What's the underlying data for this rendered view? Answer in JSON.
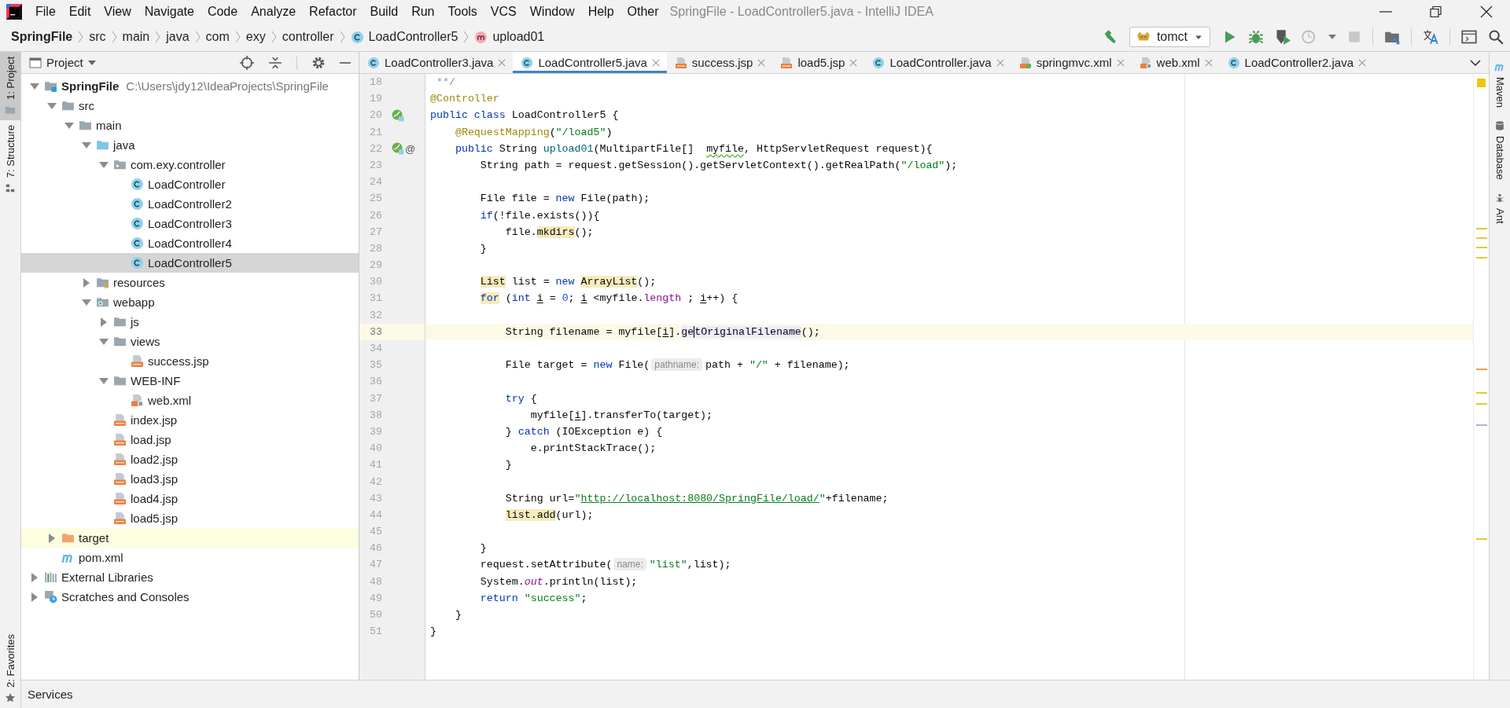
{
  "window": {
    "title": "SpringFile - LoadController5.java - IntelliJ IDEA"
  },
  "menu": [
    "File",
    "Edit",
    "View",
    "Navigate",
    "Code",
    "Analyze",
    "Refactor",
    "Build",
    "Run",
    "Tools",
    "VCS",
    "Window",
    "Help",
    "Other"
  ],
  "breadcrumbs": [
    {
      "label": "SpringFile",
      "kind": "path"
    },
    {
      "label": "src",
      "kind": "path"
    },
    {
      "label": "main",
      "kind": "path"
    },
    {
      "label": "java",
      "kind": "path"
    },
    {
      "label": "com",
      "kind": "path"
    },
    {
      "label": "exy",
      "kind": "path"
    },
    {
      "label": "controller",
      "kind": "path"
    },
    {
      "label": "LoadController5",
      "kind": "class"
    },
    {
      "label": "upload01",
      "kind": "method"
    }
  ],
  "run_config": {
    "label": "tomct"
  },
  "left_stripe": [
    {
      "label": "1: Project",
      "kind": "folder",
      "selected": true
    },
    {
      "label": "7: Structure",
      "kind": "structure",
      "selected": false
    },
    {
      "label": "2: Favorites",
      "kind": "star",
      "selected": false
    }
  ],
  "right_stripe": [
    {
      "label": "Maven",
      "kind": "m"
    },
    {
      "label": "Database",
      "kind": "db"
    },
    {
      "label": "Ant",
      "kind": "ant"
    }
  ],
  "project": {
    "title": "Project",
    "tree": [
      {
        "label": "SpringFile",
        "note": "C:\\Users\\jdy12\\IdeaProjects\\SpringFile",
        "kind": "module",
        "expanded": true,
        "selected": false,
        "highlighted": false,
        "children": [
          {
            "label": "src",
            "kind": "folder",
            "expanded": true,
            "selected": false,
            "highlighted": false,
            "children": [
              {
                "label": "main",
                "kind": "folder",
                "expanded": true,
                "selected": false,
                "highlighted": false,
                "children": [
                  {
                    "label": "java",
                    "kind": "source",
                    "expanded": true,
                    "selected": false,
                    "highlighted": false,
                    "children": [
                      {
                        "label": "com.exy.controller",
                        "kind": "package",
                        "expanded": true,
                        "selected": false,
                        "highlighted": false,
                        "children": [
                          {
                            "label": "LoadController",
                            "kind": "class",
                            "selected": false,
                            "highlighted": false
                          },
                          {
                            "label": "LoadController2",
                            "kind": "class",
                            "selected": false,
                            "highlighted": false
                          },
                          {
                            "label": "LoadController3",
                            "kind": "class",
                            "selected": false,
                            "highlighted": false
                          },
                          {
                            "label": "LoadController4",
                            "kind": "class",
                            "selected": false,
                            "highlighted": false
                          },
                          {
                            "label": "LoadController5",
                            "kind": "class",
                            "selected": true,
                            "highlighted": false
                          }
                        ]
                      }
                    ]
                  },
                  {
                    "label": "resources",
                    "kind": "resources",
                    "expanded": false,
                    "selected": false,
                    "highlighted": false
                  },
                  {
                    "label": "webapp",
                    "kind": "web",
                    "expanded": true,
                    "selected": false,
                    "highlighted": false,
                    "children": [
                      {
                        "label": "js",
                        "kind": "folder",
                        "expanded": false,
                        "selected": false,
                        "highlighted": false
                      },
                      {
                        "label": "views",
                        "kind": "folder",
                        "expanded": true,
                        "selected": false,
                        "highlighted": false,
                        "children": [
                          {
                            "label": "success.jsp",
                            "kind": "jsp",
                            "selected": false,
                            "highlighted": false
                          }
                        ]
                      },
                      {
                        "label": "WEB-INF",
                        "kind": "folder",
                        "expanded": true,
                        "selected": false,
                        "highlighted": false,
                        "children": [
                          {
                            "label": "web.xml",
                            "kind": "xml",
                            "selected": false,
                            "highlighted": false
                          }
                        ]
                      },
                      {
                        "label": "index.jsp",
                        "kind": "jsp",
                        "selected": false,
                        "highlighted": false
                      },
                      {
                        "label": "load.jsp",
                        "kind": "jsp",
                        "selected": false,
                        "highlighted": false
                      },
                      {
                        "label": "load2.jsp",
                        "kind": "jsp",
                        "selected": false,
                        "highlighted": false
                      },
                      {
                        "label": "load3.jsp",
                        "kind": "jsp",
                        "selected": false,
                        "highlighted": false
                      },
                      {
                        "label": "load4.jsp",
                        "kind": "jsp",
                        "selected": false,
                        "highlighted": false
                      },
                      {
                        "label": "load5.jsp",
                        "kind": "jsp",
                        "selected": false,
                        "highlighted": false
                      }
                    ]
                  }
                ]
              }
            ]
          },
          {
            "label": "target",
            "kind": "excluded",
            "expanded": false,
            "selected": false,
            "highlighted": true
          },
          {
            "label": "pom.xml",
            "kind": "m",
            "selected": false,
            "highlighted": false
          }
        ]
      },
      {
        "label": "External Libraries",
        "kind": "libraries",
        "expanded": false,
        "selected": false,
        "highlighted": false
      },
      {
        "label": "Scratches and Consoles",
        "kind": "scratches",
        "expanded": false,
        "selected": false,
        "highlighted": false
      }
    ]
  },
  "editor": {
    "tabs": [
      {
        "label": "LoadController3.java",
        "kind": "class",
        "selected": false
      },
      {
        "label": "LoadController5.java",
        "kind": "class",
        "selected": true
      },
      {
        "label": "success.jsp",
        "kind": "jsp",
        "selected": false
      },
      {
        "label": "load5.jsp",
        "kind": "jsp",
        "selected": false
      },
      {
        "label": "LoadController.java",
        "kind": "class",
        "selected": false
      },
      {
        "label": "springmvc.xml",
        "kind": "spring",
        "selected": false
      },
      {
        "label": "web.xml",
        "kind": "xml",
        "selected": false
      },
      {
        "label": "LoadController2.java",
        "kind": "class",
        "selected": false
      }
    ],
    "lines": [
      {
        "number": "18",
        "current": false,
        "tokens": [
          {
            "kind": "comment",
            "text": " **/"
          }
        ]
      },
      {
        "number": "19",
        "current": false,
        "tokens": [
          {
            "kind": "ann",
            "text": "@Controller"
          }
        ]
      },
      {
        "number": "20",
        "current": false,
        "gutter": [
          {
            "kind": "bean"
          }
        ],
        "tokens": [
          {
            "kind": "kw",
            "text": "public class"
          },
          {
            "kind": "plain",
            "text": " LoadController5 {"
          }
        ]
      },
      {
        "number": "21",
        "current": false,
        "tokens": [
          {
            "kind": "ann",
            "text": "@RequestMapping"
          },
          {
            "kind": "plain",
            "text": "("
          },
          {
            "kind": "str",
            "text": "\"/load5\""
          },
          {
            "kind": "plain",
            "text": ")"
          }
        ]
      },
      {
        "number": "22",
        "current": false,
        "gutter": [
          {
            "kind": "bean"
          },
          {
            "kind": "mark",
            "text": "@"
          }
        ],
        "tokens": [
          {
            "kind": "kw",
            "text": "public"
          },
          {
            "kind": "plain",
            "text": " String "
          },
          {
            "kind": "decl",
            "text": "upload01"
          },
          {
            "kind": "plain",
            "text": "(MultipartFile[]  "
          },
          {
            "kind": "typo",
            "text": "myfile"
          },
          {
            "kind": "plain",
            "text": ", HttpServletRequest request){"
          }
        ]
      },
      {
        "number": "23",
        "current": false,
        "tokens": [
          {
            "kind": "plain",
            "text": "String path = request.getSession().getServletContext().getRealPath("
          },
          {
            "kind": "str",
            "text": "\"/load\""
          },
          {
            "kind": "plain",
            "text": ");"
          }
        ]
      },
      {
        "number": "24",
        "current": false
      },
      {
        "number": "25",
        "current": false,
        "tokens": [
          {
            "kind": "plain",
            "text": "File file = "
          },
          {
            "kind": "kw",
            "text": "new"
          },
          {
            "kind": "plain",
            "text": " File(path);"
          }
        ]
      },
      {
        "number": "26",
        "current": false,
        "tokens": [
          {
            "kind": "kw",
            "text": "if"
          },
          {
            "kind": "plain",
            "text": "(!file.exists()){"
          }
        ]
      },
      {
        "number": "27",
        "current": false,
        "tokens": [
          {
            "kind": "plain",
            "text": "file."
          },
          {
            "kind": "usage",
            "text": "mkdirs"
          },
          {
            "kind": "plain",
            "text": "();"
          }
        ]
      },
      {
        "number": "28",
        "current": false,
        "tokens": [
          {
            "kind": "plain",
            "text": "}"
          }
        ]
      },
      {
        "number": "29",
        "current": false
      },
      {
        "number": "30",
        "current": false,
        "tokens": [
          {
            "kind": "usage",
            "text": "List"
          },
          {
            "kind": "plain",
            "text": " list = "
          },
          {
            "kind": "kw",
            "text": "new "
          },
          {
            "kind": "usage",
            "text": "ArrayList"
          },
          {
            "kind": "plain",
            "text": "();"
          }
        ]
      },
      {
        "number": "31",
        "current": false,
        "tokens": [
          {
            "kind": "kw-usage",
            "text": "for"
          },
          {
            "kind": "plain",
            "text": " ("
          },
          {
            "kind": "kw",
            "text": "int "
          },
          {
            "kind": "var",
            "text": "i"
          },
          {
            "kind": "plain",
            "text": " = "
          },
          {
            "kind": "num",
            "text": "0"
          },
          {
            "kind": "plain",
            "text": "; "
          },
          {
            "kind": "var",
            "text": "i"
          },
          {
            "kind": "plain",
            "text": " <myfile."
          },
          {
            "kind": "member",
            "text": "length"
          },
          {
            "kind": "plain",
            "text": " ; "
          },
          {
            "kind": "var",
            "text": "i"
          },
          {
            "kind": "plain",
            "text": "++) {"
          }
        ]
      },
      {
        "number": "32",
        "current": false
      },
      {
        "number": "33",
        "current": true,
        "tokens": [
          {
            "kind": "plain",
            "text": "String filename = myfile["
          },
          {
            "kind": "var",
            "text": "i"
          },
          {
            "kind": "plain",
            "text": "]."
          },
          {
            "kind": "sel",
            "text": "ge"
          },
          {
            "kind": "sel-caret",
            "text": "tOriginalFilename"
          },
          {
            "kind": "plain",
            "text": "();"
          }
        ]
      },
      {
        "number": "34",
        "current": false
      },
      {
        "number": "35",
        "current": false,
        "tokens": [
          {
            "kind": "plain",
            "text": "File target = "
          },
          {
            "kind": "kw",
            "text": "new"
          },
          {
            "kind": "plain",
            "text": " File("
          },
          {
            "kind": "hint",
            "text": "pathname:"
          },
          {
            "kind": "plain",
            "text": "path + "
          },
          {
            "kind": "str",
            "text": "\"/\""
          },
          {
            "kind": "plain",
            "text": " + filename);"
          }
        ]
      },
      {
        "number": "36",
        "current": false
      },
      {
        "number": "37",
        "current": false,
        "tokens": [
          {
            "kind": "kw",
            "text": "try"
          },
          {
            "kind": "plain",
            "text": " {"
          }
        ]
      },
      {
        "number": "38",
        "current": false,
        "tokens": [
          {
            "kind": "plain",
            "text": "myfile["
          },
          {
            "kind": "var",
            "text": "i"
          },
          {
            "kind": "plain",
            "text": "].transferTo(target);"
          }
        ]
      },
      {
        "number": "39",
        "current": false,
        "tokens": [
          {
            "kind": "plain",
            "text": "} "
          },
          {
            "kind": "kw",
            "text": "catch"
          },
          {
            "kind": "plain",
            "text": " (IOException e) {"
          }
        ]
      },
      {
        "number": "40",
        "current": false,
        "tokens": [
          {
            "kind": "plain",
            "text": "e.printStackTrace();"
          }
        ]
      },
      {
        "number": "41",
        "current": false,
        "tokens": [
          {
            "kind": "plain",
            "text": "}"
          }
        ]
      },
      {
        "number": "42",
        "current": false
      },
      {
        "number": "43",
        "current": false,
        "tokens": [
          {
            "kind": "plain",
            "text": "String url="
          },
          {
            "kind": "str",
            "text": "\""
          },
          {
            "kind": "link",
            "text": "http://localhost:8080/SpringFile/load/"
          },
          {
            "kind": "str",
            "text": "\""
          },
          {
            "kind": "plain",
            "text": "+filename;"
          }
        ]
      },
      {
        "number": "44",
        "current": false,
        "tokens": [
          {
            "kind": "usage",
            "text": "list.add"
          },
          {
            "kind": "plain",
            "text": "(url);"
          }
        ]
      },
      {
        "number": "45",
        "current": false
      },
      {
        "number": "46",
        "current": false,
        "tokens": [
          {
            "kind": "plain",
            "text": "}"
          }
        ]
      },
      {
        "number": "47",
        "current": false,
        "tokens": [
          {
            "kind": "plain",
            "text": "request.setAttribute("
          },
          {
            "kind": "hint",
            "text": "name:"
          },
          {
            "kind": "str",
            "text": "\"list\""
          },
          {
            "kind": "plain",
            "text": ",list);"
          }
        ]
      },
      {
        "number": "48",
        "current": false,
        "tokens": [
          {
            "kind": "plain",
            "text": "System."
          },
          {
            "kind": "field",
            "text": "out"
          },
          {
            "kind": "plain",
            "text": ".println(list);"
          }
        ]
      },
      {
        "number": "49",
        "current": false,
        "tokens": [
          {
            "kind": "kw",
            "text": "return "
          },
          {
            "kind": "str",
            "text": "\"success\""
          },
          {
            "kind": "plain",
            "text": ";"
          }
        ]
      },
      {
        "number": "50",
        "current": false,
        "tokens": [
          {
            "kind": "plain",
            "text": "}"
          }
        ]
      },
      {
        "number": "51",
        "current": false,
        "tokens": [
          {
            "kind": "plain",
            "text": "}"
          }
        ]
      }
    ]
  },
  "bottom_bar": {
    "label": "Services"
  }
}
